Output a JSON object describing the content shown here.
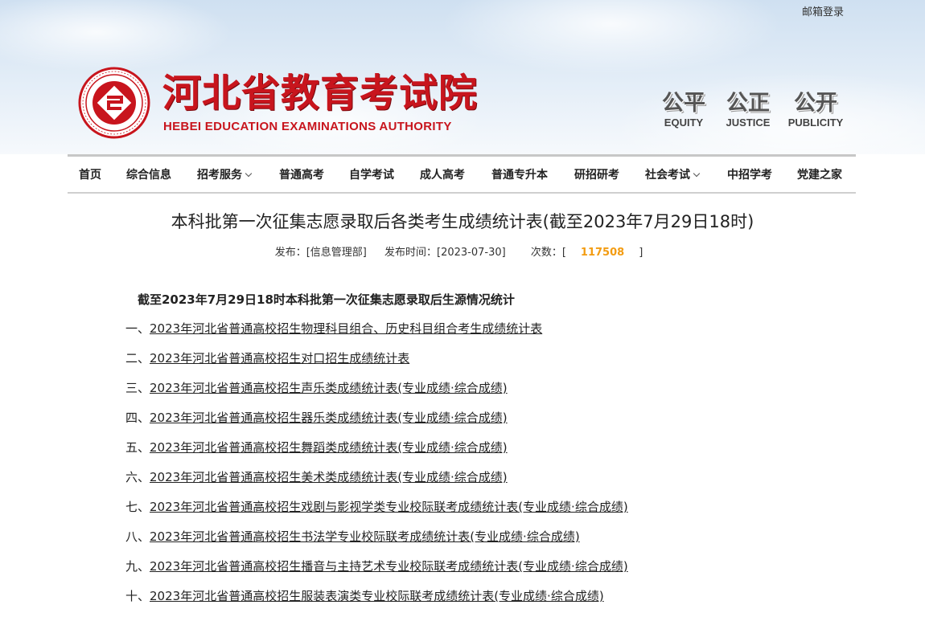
{
  "header": {
    "mail_link": "邮箱登录",
    "logo_cn": "河北省教育考试院",
    "logo_en": "HEBEI EDUCATION EXAMINATIONS AUTHORITY",
    "mottos": [
      {
        "cn": "公平",
        "en": "EQUITY"
      },
      {
        "cn": "公正",
        "en": "JUSTICE"
      },
      {
        "cn": "公开",
        "en": "PUBLICITY"
      }
    ],
    "brand_color": "#c8151d"
  },
  "nav": {
    "items": [
      {
        "label": "首页",
        "dropdown": false
      },
      {
        "label": "综合信息",
        "dropdown": false
      },
      {
        "label": "招考服务",
        "dropdown": true
      },
      {
        "label": "普通高考",
        "dropdown": false
      },
      {
        "label": "自学考试",
        "dropdown": false
      },
      {
        "label": "成人高考",
        "dropdown": false
      },
      {
        "label": "普通专升本",
        "dropdown": false
      },
      {
        "label": "研招研考",
        "dropdown": false
      },
      {
        "label": "社会考试",
        "dropdown": true
      },
      {
        "label": "中招学考",
        "dropdown": false
      },
      {
        "label": "党建之家",
        "dropdown": false
      }
    ]
  },
  "article": {
    "title": "本科批第一次征集志愿录取后各类考生成绩统计表(截至2023年7月29日18时)",
    "meta": {
      "publisher_label": "发布：[信息管理部]",
      "time_label": "发布时间：[2023-07-30]",
      "views_prefix": "次数：[",
      "views_count": "117508",
      "views_suffix": "]"
    },
    "section_heading": "截至2023年7月29日18时本科批第一次征集志愿录取后生源情况统计",
    "items": [
      {
        "num": "一、",
        "text": "2023年河北省普通高校招生物理科目组合、历史科目组合考生成绩统计表"
      },
      {
        "num": "二、",
        "text": "2023年河北省普通高校招生对口招生成绩统计表"
      },
      {
        "num": "三、",
        "text": "2023年河北省普通高校招生声乐类成绩统计表(专业成绩·综合成绩)"
      },
      {
        "num": "四、",
        "text": "2023年河北省普通高校招生器乐类成绩统计表(专业成绩·综合成绩)"
      },
      {
        "num": "五、",
        "text": "2023年河北省普通高校招生舞蹈类成绩统计表(专业成绩·综合成绩)"
      },
      {
        "num": "六、",
        "text": "2023年河北省普通高校招生美术类成绩统计表(专业成绩·综合成绩)"
      },
      {
        "num": "七、",
        "text": "2023年河北省普通高校招生戏剧与影视学类专业校际联考成绩统计表(专业成绩·综合成绩)"
      },
      {
        "num": "八、",
        "text": "2023年河北省普通高校招生书法学专业校际联考成绩统计表(专业成绩·综合成绩)"
      },
      {
        "num": "九、",
        "text": "2023年河北省普通高校招生播音与主持艺术专业校际联考成绩统计表(专业成绩·综合成绩)"
      },
      {
        "num": "十、",
        "text": "2023年河北省普通高校招生服装表演类专业校际联考成绩统计表(专业成绩·综合成绩)"
      }
    ]
  }
}
